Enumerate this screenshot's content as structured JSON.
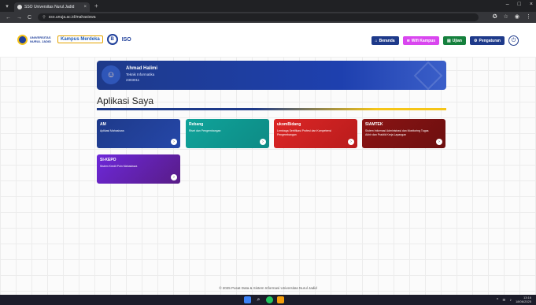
{
  "browser": {
    "tab_title": "SSO Universitas Nurul Jadid",
    "tab_close": "×",
    "new_tab": "+",
    "url": "sso.unuja.ac.id/mahasiswa",
    "nav_back": "←",
    "nav_forward": "→",
    "nav_reload": "C",
    "window_min": "–",
    "window_max": "□",
    "window_close": "×"
  },
  "header": {
    "logo_univ_text": "UNIVERSITAS NURUL JADID",
    "logo_kampus_text": "Kampus Merdeka",
    "logo_b_text": "B",
    "logo_iso_text": "ISO",
    "buttons": {
      "beranda": "Beranda",
      "wifi": "Wifi Kampus",
      "ujian": "Ujian",
      "pengaturan": "Pengaturan"
    }
  },
  "profile": {
    "name": "Ahmad Halimi",
    "prodi": "Teknik Informatika",
    "nim": "2303011"
  },
  "main": {
    "title": "Aplikasi Saya",
    "cards": [
      {
        "title": "AM",
        "desc": "Aplikasi Mahasiswa"
      },
      {
        "title": "Rebang",
        "desc": "Riset dan Pengembangan"
      },
      {
        "title": "ukomBidang",
        "desc": "Lembaga Sertifikasi Profesi dan Kompetensi Pengembangan"
      },
      {
        "title": "SIAMTEK",
        "desc": "Sistem Informasi Administrasi dan Monitoring Tugas Akhir dan Praktik Kerja Lapangan"
      },
      {
        "title": "SI-KEPO",
        "desc": "Sistem Kredit Poin Mahasiswa"
      }
    ]
  },
  "footer": {
    "text": "© 2025 Pusat Data & Sistem Informasi Universitas Nurul Jadid"
  },
  "taskbar": {
    "time": "13:16",
    "date": "18/06/2025"
  },
  "colors": {
    "primary": "#1e3a8a",
    "accent": "#f5c518",
    "wifi": "#d946ef",
    "ujian": "#15803d",
    "card_rebang": "#10a39a",
    "card_ukom": "#dc2626",
    "card_siamtek": "#8b1414",
    "card_sikepo": "#6d28d9"
  }
}
